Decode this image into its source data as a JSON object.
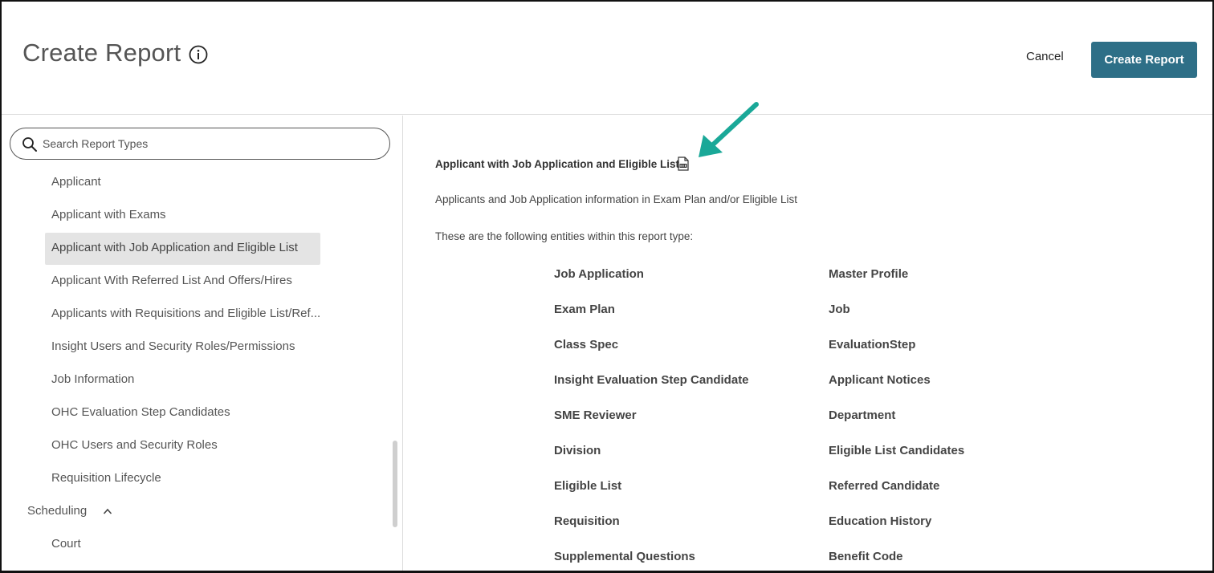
{
  "header": {
    "title": "Create Report",
    "cancel_label": "Cancel",
    "create_label": "Create Report"
  },
  "search": {
    "placeholder": "Search Report Types",
    "value": ""
  },
  "report_types": [
    {
      "label": "Applicant",
      "selected": false
    },
    {
      "label": "Applicant with Exams",
      "selected": false
    },
    {
      "label": "Applicant with Job Application and Eligible List",
      "selected": true
    },
    {
      "label": "Applicant With Referred List And Offers/Hires",
      "selected": false
    },
    {
      "label": "Applicants with Requisitions and Eligible List/Ref...",
      "selected": false
    },
    {
      "label": "Insight Users and Security Roles/Permissions",
      "selected": false
    },
    {
      "label": "Job Information",
      "selected": false
    },
    {
      "label": "OHC Evaluation Step Candidates",
      "selected": false
    },
    {
      "label": "OHC Users and Security Roles",
      "selected": false
    },
    {
      "label": "Requisition Lifecycle",
      "selected": false
    }
  ],
  "category": {
    "label": "Scheduling",
    "items": [
      "Court"
    ]
  },
  "detail": {
    "title": "Applicant with Job Application and Eligible List",
    "description": "Applicants and Job Application information in Exam Plan and/or Eligible List",
    "entities_intro": "These are the following entities within this report type:",
    "entities_left": [
      "Job Application",
      "Exam Plan",
      "Class Spec",
      "Insight Evaluation Step Candidate",
      "SME Reviewer",
      "Division",
      "Eligible List",
      "Requisition",
      "Supplemental Questions"
    ],
    "entities_right": [
      "Master Profile",
      "Job",
      "EvaluationStep",
      "Applicant Notices",
      "Department",
      "Eligible List Candidates",
      "Referred Candidate",
      "Education History",
      "Benefit Code"
    ]
  },
  "colors": {
    "primary_button": "#2e6f87",
    "selected_bg": "#e4e4e4",
    "annotation_arrow": "#1aa898"
  },
  "icons": [
    "info-icon",
    "search-icon",
    "chevron-up-icon",
    "pdf-icon",
    "arrow-annotation"
  ]
}
